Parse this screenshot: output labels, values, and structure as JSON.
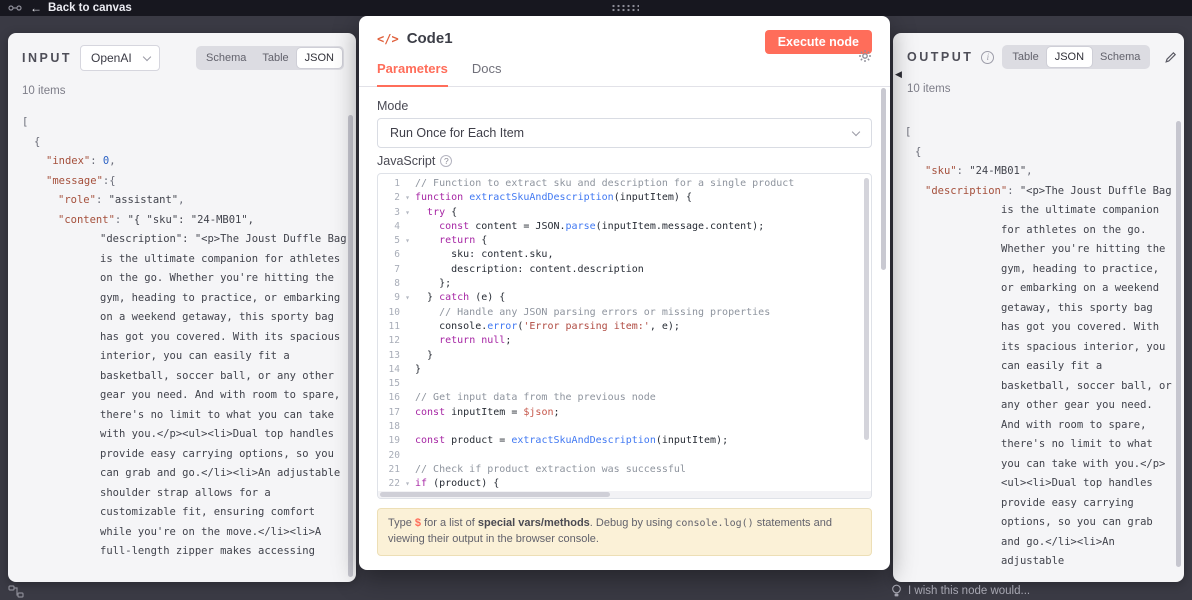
{
  "topbar": {
    "back_label": "Back to canvas"
  },
  "input_panel": {
    "title": "INPUT",
    "source_select": {
      "value": "OpenAI"
    },
    "tabs": [
      "Schema",
      "Table",
      "JSON"
    ],
    "active_tab": "JSON",
    "items_count": "10 items",
    "json_rows": [
      {
        "text": "[",
        "lvl": 0
      },
      {
        "text": "{",
        "lvl": 1
      },
      {
        "key": "index",
        "value": "0",
        "vt": "num",
        "comma": true,
        "lvl": 2
      },
      {
        "key": "message",
        "value": "{",
        "vt": "p",
        "tight": true,
        "lvl": 2
      },
      {
        "key": "role",
        "value": "assistant",
        "vt": "str",
        "comma": true,
        "lvl": 3
      },
      {
        "key": "content",
        "vt": "str",
        "lvl": 3,
        "hang": true,
        "cut": true,
        "value": "{ \"sku\": \"24-MB01\", \"description\": \"<p>The Joust Duffle Bag is the ultimate companion for athletes on the go. Whether you're hitting the gym, heading to practice, or embarking on a weekend getaway, this sporty bag has got you covered. With its spacious interior, you can easily fit a basketball, soccer ball, or any other gear you need. And with room to spare, there's no limit to what you can take with you.</p><ul><li>Dual top handles provide easy carrying options, so you can grab and go.</li><li>An adjustable shoulder strap allows for a customizable fit, ensuring comfort while you're on the move.</li><li>A full-length zipper makes accessing"
      }
    ]
  },
  "modal": {
    "title": "Code1",
    "node_icon": "</>",
    "execute_button": "Execute node",
    "tabs": [
      "Parameters",
      "Docs"
    ],
    "active_tab": "Parameters",
    "mode_label": "Mode",
    "mode_value": "Run Once for Each Item",
    "language_label": "JavaScript",
    "code_lines": [
      {
        "n": 1,
        "text": "// Function to extract sku and description for a single product"
      },
      {
        "n": 2,
        "fold": true,
        "text": "function extractSkuAndDescription(inputItem) {"
      },
      {
        "n": 3,
        "fold": true,
        "text": "  try {"
      },
      {
        "n": 4,
        "text": "    const content = JSON.parse(inputItem.message.content);"
      },
      {
        "n": 5,
        "fold": true,
        "text": "    return {"
      },
      {
        "n": 6,
        "text": "      sku: content.sku,"
      },
      {
        "n": 7,
        "text": "      description: content.description"
      },
      {
        "n": 8,
        "text": "    };"
      },
      {
        "n": 9,
        "fold": true,
        "text": "  } catch (e) {"
      },
      {
        "n": 10,
        "text": "    // Handle any JSON parsing errors or missing properties"
      },
      {
        "n": 11,
        "text": "    console.error('Error parsing item:', e);"
      },
      {
        "n": 12,
        "text": "    return null;"
      },
      {
        "n": 13,
        "text": "  }"
      },
      {
        "n": 14,
        "text": "}"
      },
      {
        "n": 15,
        "text": ""
      },
      {
        "n": 16,
        "text": "// Get input data from the previous node"
      },
      {
        "n": 17,
        "text": "const inputItem = $json;"
      },
      {
        "n": 18,
        "text": ""
      },
      {
        "n": 19,
        "text": "const product = extractSkuAndDescription(inputItem);"
      },
      {
        "n": 20,
        "text": ""
      },
      {
        "n": 21,
        "text": "// Check if product extraction was successful"
      },
      {
        "n": 22,
        "fold": true,
        "text": "if (product) {"
      }
    ],
    "hint": {
      "prefix": "Type ",
      "dollar": "$",
      "mid1": " for a list of ",
      "emph": "special vars/methods",
      "mid2": ". Debug by using ",
      "code": "console.log()",
      "suffix": " statements and viewing their output in the browser console."
    }
  },
  "output_panel": {
    "title": "OUTPUT",
    "tabs": [
      "Table",
      "JSON",
      "Schema"
    ],
    "active_tab": "JSON",
    "items_count": "10 items",
    "json_rows": [
      {
        "text": "[",
        "lvl": 0
      },
      {
        "text": "{",
        "lvl": 1
      },
      {
        "key": "sku",
        "value": "24-MB01",
        "vt": "str",
        "comma": true,
        "lvl": 2
      },
      {
        "key": "description",
        "vt": "str",
        "lvl": 2,
        "hang": true,
        "cut": true,
        "value": "<p>The Joust Duffle Bag is the ultimate companion for athletes on the go. Whether you're hitting the gym, heading to practice, or embarking on a weekend getaway, this sporty bag has got you covered. With its spacious interior, you can easily fit a basketball, soccer ball, or any other gear you need. And with room to spare, there's no limit to what you can take with you.</p><ul><li>Dual top handles provide easy carrying options, so you can grab and go.</li><li>An adjustable"
      }
    ]
  },
  "footer": {
    "wish_text": "I wish this node would..."
  },
  "colors": {
    "accent": "#ff6d5a",
    "node_icon_color": "#e0603c"
  }
}
